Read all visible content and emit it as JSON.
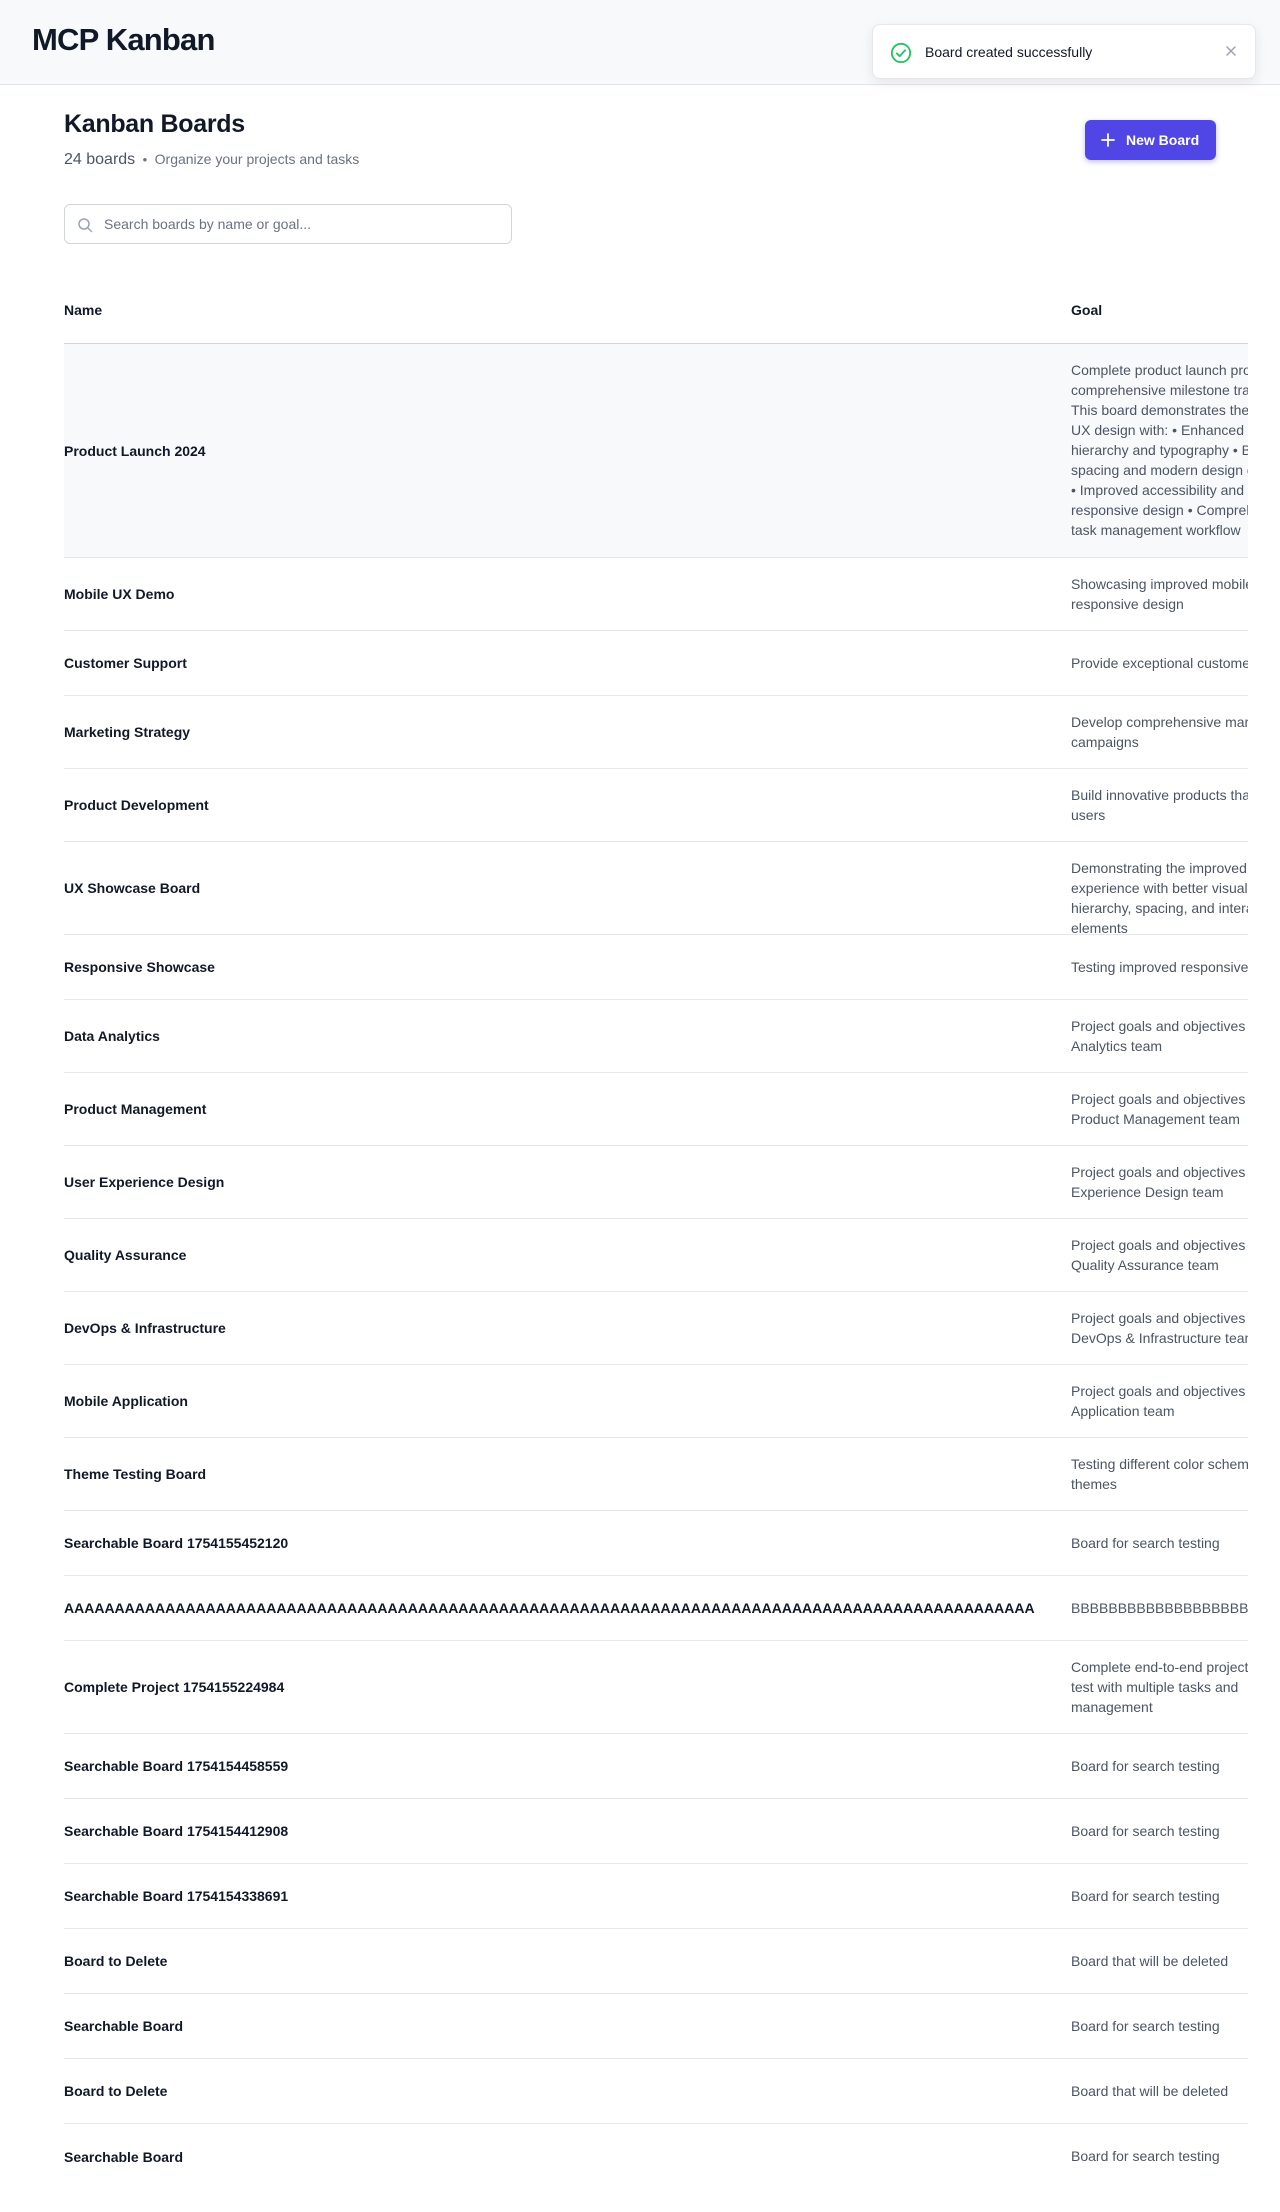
{
  "app": {
    "title": "MCP Kanban"
  },
  "toast": {
    "message": "Board created successfully",
    "status_color": "#22c55e"
  },
  "page": {
    "title": "Kanban Boards",
    "board_count": "24 boards",
    "separator": "•",
    "subtitle": "Organize your projects and tasks",
    "new_board_label": "New Board",
    "accent_color": "#4f46e5"
  },
  "search": {
    "placeholder": "Search boards by name or goal..."
  },
  "table": {
    "headers": {
      "name": "Name",
      "goal": "Goal"
    },
    "rows": [
      {
        "name": "Product Launch 2024",
        "goal": "Complete product launch process with comprehensive milestone tracking. This board demonstrates the improved UX design with: • Enhanced visual hierarchy and typography • Better spacing and modern design elements • Improved accessibility and responsive design • Comprehensive task management workflow"
      },
      {
        "name": "Mobile UX Demo",
        "goal": "Showcasing improved mobile UX and responsive design"
      },
      {
        "name": "Customer Support",
        "goal": "Provide exceptional customer support"
      },
      {
        "name": "Marketing Strategy",
        "goal": "Develop comprehensive marketing campaigns"
      },
      {
        "name": "Product Development",
        "goal": "Build innovative products that delight users"
      },
      {
        "name": "UX Showcase Board",
        "goal": "Demonstrating the improved user experience with better visual hierarchy, spacing, and interactive elements"
      },
      {
        "name": "Responsive Showcase",
        "goal": "Testing improved responsive design"
      },
      {
        "name": "Data Analytics",
        "goal": "Project goals and objectives for Data Analytics team"
      },
      {
        "name": "Product Management",
        "goal": "Project goals and objectives for Product Management team"
      },
      {
        "name": "User Experience Design",
        "goal": "Project goals and objectives for User Experience Design team"
      },
      {
        "name": "Quality Assurance",
        "goal": "Project goals and objectives for Quality Assurance team"
      },
      {
        "name": "DevOps & Infrastructure",
        "goal": "Project goals and objectives for DevOps & Infrastructure team"
      },
      {
        "name": "Mobile Application",
        "goal": "Project goals and objectives for Mobile Application team"
      },
      {
        "name": "Theme Testing Board",
        "goal": "Testing different color schemes and themes"
      },
      {
        "name": "Searchable Board 1754155452120",
        "goal": "Board for search testing"
      },
      {
        "name": "AAAAAAAAAAAAAAAAAAAAAAAAAAAAAAAAAAAAAAAAAAAAAAAAAAAAAAAAAAAAAAAAAAAAAAAAAAAAAAAAAAAAAAAAAAAAAAAA",
        "goal": "BBBBBBBBBBBBBBBBBBBBBBBBBBBBBBBBBBBBBBBB"
      },
      {
        "name": "Complete Project 1754155224984",
        "goal": "Complete end-to-end project workflow test with multiple tasks and management"
      },
      {
        "name": "Searchable Board 1754154458559",
        "goal": "Board for search testing"
      },
      {
        "name": "Searchable Board 1754154412908",
        "goal": "Board for search testing"
      },
      {
        "name": "Searchable Board 1754154338691",
        "goal": "Board for search testing"
      },
      {
        "name": "Board to Delete",
        "goal": "Board that will be deleted"
      },
      {
        "name": "Searchable Board",
        "goal": "Board for search testing"
      },
      {
        "name": "Board to Delete",
        "goal": "Board that will be deleted"
      },
      {
        "name": "Searchable Board",
        "goal": "Board for search testing"
      }
    ]
  }
}
